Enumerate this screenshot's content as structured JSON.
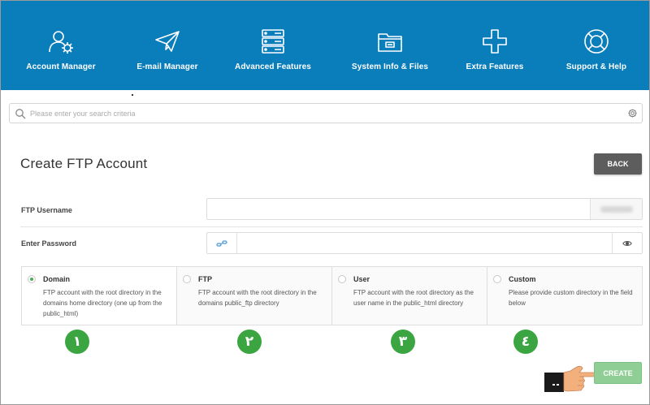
{
  "nav": {
    "items": [
      {
        "label": "Account Manager",
        "icon": "account-manager-icon"
      },
      {
        "label": "E-mail Manager",
        "icon": "paper-plane-icon"
      },
      {
        "label": "Advanced Features",
        "icon": "server-icon"
      },
      {
        "label": "System Info & Files",
        "icon": "folder-icon"
      },
      {
        "label": "Extra Features",
        "icon": "plus-icon"
      },
      {
        "label": "Support & Help",
        "icon": "lifebuoy-icon"
      }
    ]
  },
  "search": {
    "placeholder": "Please enter your search criteria"
  },
  "page": {
    "title": "Create FTP Account",
    "back_label": "BACK"
  },
  "form": {
    "username_label": "FTP Username",
    "password_label": "Enter Password"
  },
  "options": [
    {
      "title": "Domain",
      "description": "FTP account with the root directory in the domains home directory (one up from the public_html)",
      "selected": true
    },
    {
      "title": "FTP",
      "description": "FTP account with the root directory in the domains public_ftp directory",
      "selected": false
    },
    {
      "title": "User",
      "description": "FTP account with the root directory as the user name in the public_html directory",
      "selected": false
    },
    {
      "title": "Custom",
      "description": "Please provide custom directory in the field below",
      "selected": false
    }
  ],
  "badges": [
    "١",
    "٢",
    "٣",
    "٤"
  ],
  "actions": {
    "create_label": "CREATE"
  },
  "colors": {
    "nav_bg": "#0a7dbb",
    "back_bg": "#5d5d5d",
    "create_bg": "#8fcf95",
    "badge_bg": "#3aa541",
    "radio_selected": "#4caf50"
  }
}
